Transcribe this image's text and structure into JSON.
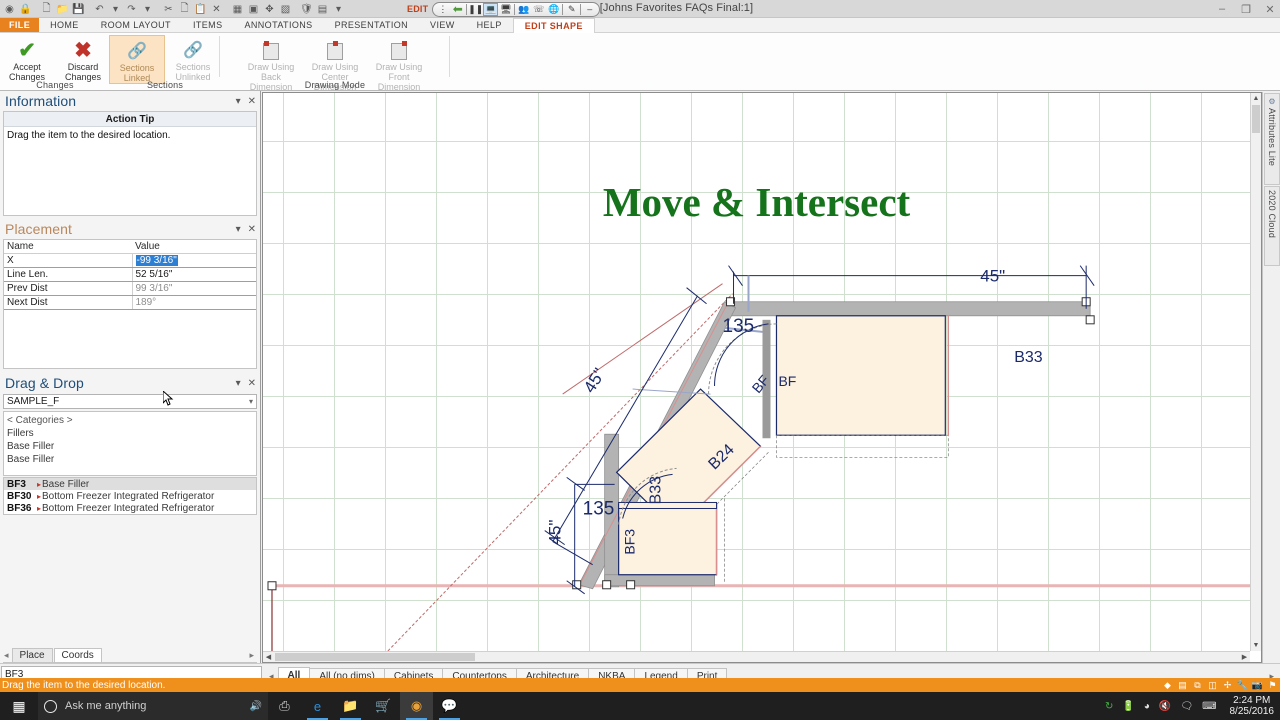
{
  "titlebar": {
    "window_title": "2020 Design - [Johns Favorites FAQs Final:1]",
    "quick_access_icons": [
      "app-logo-icon",
      "lock-icon",
      "new-icon",
      "open-icon",
      "save-icon",
      "undo-icon",
      "redo-icon",
      "cut-icon",
      "copy-icon",
      "paste-icon",
      "delete-icon",
      "table-icon",
      "report-icon",
      "arrange-icon",
      "render-icon",
      "shield-icon",
      "panel-icon",
      "more-icon"
    ],
    "window_buttons": [
      "minimize",
      "restore",
      "close"
    ],
    "edit_float": {
      "label": "EDIT",
      "buttons": [
        "back-arrow-icon",
        "pause-icon",
        "monitor-icon",
        "monitor-share-icon",
        "presenter-icon",
        "phone-icon",
        "globe-icon",
        "pen-icon",
        "minus-icon"
      ]
    }
  },
  "ribbon": {
    "tabs": [
      {
        "label": "FILE",
        "kind": "file"
      },
      {
        "label": "HOME",
        "kind": "normal"
      },
      {
        "label": "ROOM LAYOUT",
        "kind": "normal"
      },
      {
        "label": "ITEMS",
        "kind": "normal"
      },
      {
        "label": "ANNOTATIONS",
        "kind": "normal"
      },
      {
        "label": "PRESENTATION",
        "kind": "normal"
      },
      {
        "label": "VIEW",
        "kind": "normal"
      },
      {
        "label": "HELP",
        "kind": "normal"
      },
      {
        "label": "EDIT SHAPE",
        "kind": "active"
      }
    ],
    "groups": [
      {
        "name": "Changes",
        "buttons": [
          {
            "label": "Accept\nChanges",
            "line1": "Accept",
            "line2": "Changes",
            "icon": "check-icon",
            "state": "enabled"
          },
          {
            "label": "Discard\nChanges",
            "line1": "Discard",
            "line2": "Changes",
            "icon": "cross-icon",
            "state": "enabled"
          }
        ]
      },
      {
        "name": "Sections",
        "buttons": [
          {
            "line1": "Sections",
            "line2": "Linked",
            "icon": "chain-linked-icon",
            "state": "active"
          },
          {
            "line1": "Sections",
            "line2": "Unlinked",
            "icon": "chain-broken-icon",
            "state": "disabled"
          }
        ]
      },
      {
        "name": "Drawing Mode",
        "buttons": [
          {
            "line1": "Draw Using",
            "line2": "Back Dimension",
            "icon": "dimension-back-icon",
            "state": "disabled"
          },
          {
            "line1": "Draw Using",
            "line2": "Center Dimension",
            "icon": "dimension-center-icon",
            "state": "disabled"
          },
          {
            "line1": "Draw Using",
            "line2": "Front Dimension",
            "icon": "dimension-front-icon",
            "state": "disabled"
          }
        ]
      }
    ]
  },
  "information_panel": {
    "title": "Information",
    "action_tip_header": "Action Tip",
    "action_tip_text": "Drag the item to the desired location."
  },
  "placement_panel": {
    "title": "Placement",
    "columns": [
      "Name",
      "Value"
    ],
    "rows": [
      {
        "name": "X",
        "value": "-99 3/16\"",
        "selected": true,
        "dim": false
      },
      {
        "name": "Line Len.",
        "value": "52 5/16\"",
        "selected": false,
        "dim": false
      },
      {
        "name": "Prev Dist",
        "value": "99 3/16\"",
        "selected": false,
        "dim": true
      },
      {
        "name": "Next Dist",
        "value": "189°",
        "selected": false,
        "dim": true
      }
    ],
    "tabs": [
      {
        "label": "Place",
        "active": false
      },
      {
        "label": "Coords",
        "active": true
      }
    ]
  },
  "dragdrop_panel": {
    "title": "Drag & Drop",
    "catalog_value": "SAMPLE_F",
    "breadcrumbs": [
      "< Categories >",
      "Fillers",
      "Base Filler",
      "Base Filler"
    ],
    "items": [
      {
        "code": "BF3",
        "desc": "Base Filler",
        "selected": true
      },
      {
        "code": "BF30",
        "desc": "Bottom Freezer Integrated Refrigerator",
        "selected": false
      },
      {
        "code": "BF36",
        "desc": "Bottom Freezer Integrated Refrigerator",
        "selected": false
      }
    ]
  },
  "plan": {
    "title": "Move & Intersect",
    "title_color": "#15731b",
    "grid": true,
    "labels": [
      {
        "text": "45\"",
        "kind": "dimension",
        "position": "top"
      },
      {
        "text": "45\"",
        "kind": "dimension",
        "position": "upper-left-diagonal"
      },
      {
        "text": "45\"",
        "kind": "dimension",
        "position": "left-vertical"
      },
      {
        "text": "135",
        "kind": "angle",
        "position": "upper-corner"
      },
      {
        "text": "135",
        "kind": "angle",
        "position": "lower-corner"
      },
      {
        "text": "B33",
        "kind": "cabinet",
        "position": "right"
      },
      {
        "text": "B33",
        "kind": "cabinet",
        "position": "bottom"
      },
      {
        "text": "B24",
        "kind": "cabinet",
        "position": "diagonal"
      },
      {
        "text": "BF",
        "kind": "filler",
        "position": "upper-right"
      },
      {
        "text": "BF",
        "kind": "filler",
        "position": "upper-right-2"
      },
      {
        "text": "BF3",
        "kind": "filler",
        "position": "lower-mid"
      }
    ]
  },
  "rightrail": {
    "tabs": [
      {
        "label": "Attributes Lite",
        "icon": "attributes-icon"
      },
      {
        "label": "2020 Cloud",
        "icon": "cloud-icon"
      }
    ]
  },
  "bottom": {
    "status_value": "BF3",
    "view_tabs": [
      {
        "label": "All",
        "active": true
      },
      {
        "label": "All (no dims)",
        "active": false
      },
      {
        "label": "Cabinets",
        "active": false
      },
      {
        "label": "Countertops",
        "active": false
      },
      {
        "label": "Architecture",
        "active": false
      },
      {
        "label": "NKBA",
        "active": false
      },
      {
        "label": "Legend",
        "active": false
      },
      {
        "label": "Print",
        "active": false
      }
    ],
    "hint_text": "Drag the item to the desired location.",
    "tray_icons": [
      "diamond-icon",
      "grid-icon",
      "snap-icon",
      "layers-icon",
      "nudge-icon",
      "wrench-icon",
      "camera-icon",
      "flag-icon"
    ]
  },
  "taskbar": {
    "search_placeholder": "Ask me anything",
    "icons": [
      "start-icon",
      "cortana-circle-icon",
      "microphone-icon",
      "task-view-icon",
      "edge-icon",
      "file-explorer-icon",
      "store-icon",
      "app-2020-icon",
      "messaging-icon"
    ],
    "tray": [
      "sync-icon",
      "battery-icon",
      "wifi-icon",
      "volume-mute-icon",
      "action-center-icon",
      "keyboard-icon"
    ],
    "clock_time": "2:24 PM",
    "clock_date": "8/25/2016"
  },
  "colors": {
    "accent_orange": "#ef8f1c",
    "cabinet_fill": "#fdf2e0",
    "wall_fill": "#b3b3b3",
    "plan_line": "#1b2a6b",
    "grid_line": "#cfe0cf",
    "red_guide": "#d08a8a",
    "selection_blue": "#2d7fd3"
  }
}
